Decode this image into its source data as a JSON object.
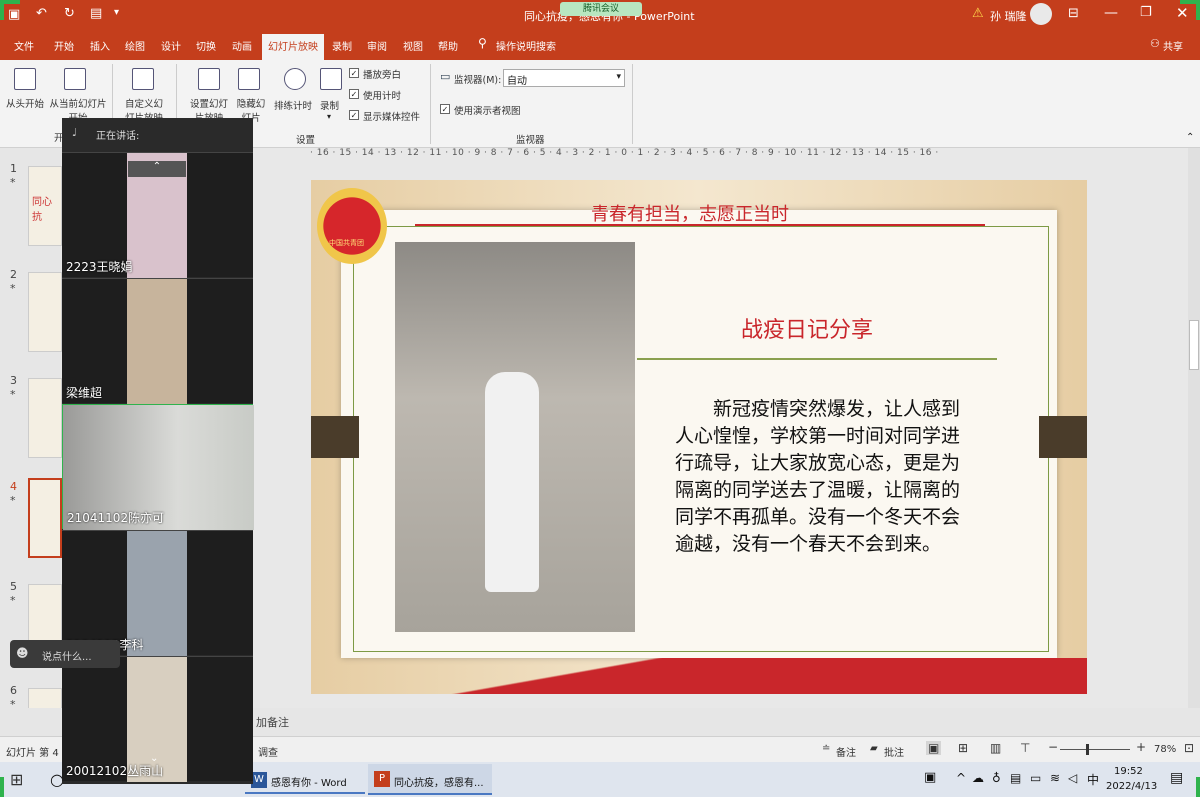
{
  "window": {
    "title": "同心抗疫，感恩有你 - PowerPoint",
    "meeting_badge": "腾讯会议",
    "user": "孙 瑞隆"
  },
  "tabs": [
    "文件",
    "开始",
    "插入",
    "绘图",
    "设计",
    "切换",
    "动画",
    "幻灯片放映",
    "录制",
    "审阅",
    "视图",
    "帮助"
  ],
  "tell_me": "操作说明搜索",
  "share": "共享",
  "ribbon": {
    "start_from_beginning": "从头开始",
    "from_current": "从当前幻灯片开始",
    "custom_show": "自定义幻灯片放映",
    "setup_show": "设置幻灯片放映",
    "hide_slide": "隐藏幻灯片",
    "rehearse": "排练计时",
    "record": "录制",
    "play_narration": "播放旁白",
    "use_timings": "使用计时",
    "show_media_controls": "显示媒体控件",
    "group_start": "开始",
    "group_setup": "设置",
    "group_monitors": "监视器",
    "monitor_label": "监视器(M):",
    "monitor_value": "自动",
    "presenter_view": "使用演示者视图"
  },
  "ruler_text": "· 16 · 15 · 14 · 13 · 12 · 11 · 10 · 9 · 8 · 7 · 6 · 5 · 4 · 3 · 2 · 1 · 0 · 1 · 2 · 3 · 4 · 5 · 6 · 7 · 8 · 9 · 10 · 11 · 12 · 13 · 14 · 15 · 16 ·",
  "thumbnails": [
    {
      "num": "1",
      "star": "*",
      "label": "同心抗"
    },
    {
      "num": "2",
      "star": "*"
    },
    {
      "num": "3",
      "star": "*"
    },
    {
      "num": "4",
      "star": "*"
    },
    {
      "num": "5",
      "star": "*"
    },
    {
      "num": "6",
      "star": "*"
    }
  ],
  "slide": {
    "header": "青春有担当，志愿正当时",
    "title": "战疫日记分享",
    "body": "新冠疫情突然爆发，让人感到人心惶惶，学校第一时间对同学进行疏导，让大家放宽心态，更是为隔离的同学送去了温暖，让隔离的同学不再孤单。没有一个冬天不会逾越，没有一个春天不会到来。",
    "emblem_text": "中国共青团"
  },
  "notes_placeholder": "加备注",
  "meeting_panel": {
    "speaking_label": "正在讲话:",
    "participants": [
      {
        "name": "2223王晓娟"
      },
      {
        "name": "梁维超"
      },
      {
        "name": "21041102陈亦可"
      },
      {
        "name": "2104113李科"
      },
      {
        "name": "20012102丛雨山"
      }
    ],
    "chat_placeholder": "说点什么..."
  },
  "status": {
    "slide_of": "幻灯片 第 4 张",
    "accessibility": "调查",
    "notes": "备注",
    "comments": "批注",
    "zoom": "78%"
  },
  "taskbar": {
    "word": "感恩有你 - Word",
    "ppt": "同心抗疫，感恩有...",
    "time": "19:52",
    "date": "2022/4/13",
    "ime": "中"
  }
}
